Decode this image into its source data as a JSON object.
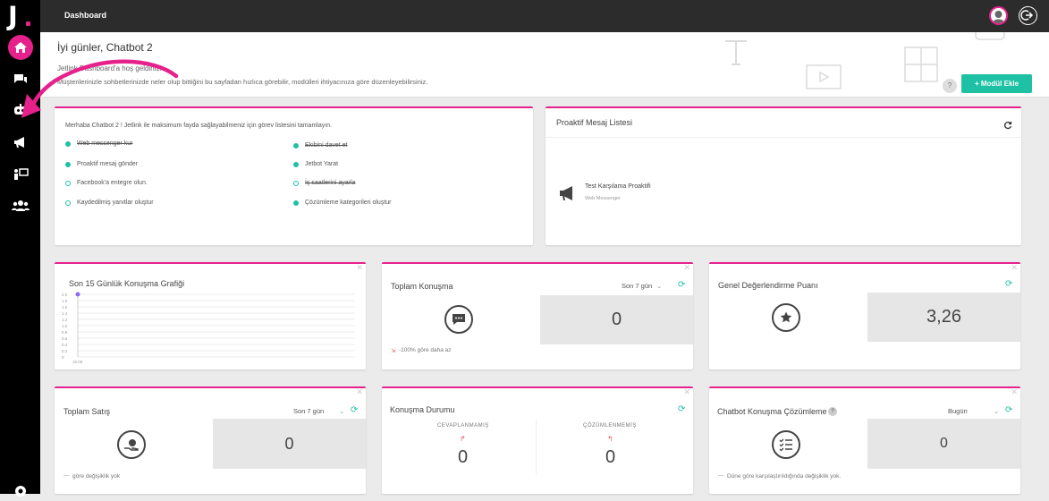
{
  "sidebar": {
    "logo": "J"
  },
  "topbar": {
    "title": "Dashboard"
  },
  "header": {
    "greeting": "İyi günler, Chatbot 2",
    "welcome": "Jetlink Dashboard'a hoş geldiniz!",
    "description": "Müşterilerinizle sohbetlerinizde neler olup bittiğini bu sayfadan hızlıca görebilir, modülleri ihtiyacınıza göre düzenleyebilirsiniz.",
    "help": "?",
    "add_module": "+ Modül Ekle"
  },
  "tasks_card": {
    "intro": "Merhaba Chatbot 2 ! Jetlink ile maksimum fayda sağlayabilmeniz için görev listesini tamamlayın.",
    "tasks": [
      {
        "label": "Web messenger kur",
        "done": true
      },
      {
        "label": "Ekibini davet et",
        "done": true
      },
      {
        "label": "Proaktif mesaj gönder",
        "done": false
      },
      {
        "label": "Jetbot Yarat",
        "done": false
      },
      {
        "label": "Facebook'a entegre olun.",
        "done": false
      },
      {
        "label": "İş saatlerini ayarla",
        "done": true
      },
      {
        "label": "Kaydedilmiş yanıtlar oluştur",
        "done": false
      },
      {
        "label": "Çözümleme kategorileri oluştur",
        "done": false
      }
    ]
  },
  "proactive": {
    "title": "Proaktif Mesaj Listesi",
    "item_title": "Test Karşılama Proaktifi",
    "item_sub": "Web Messenger"
  },
  "chart15": {
    "title": "Son 15 Günlük Konuşma Grafiği",
    "x_label": "16.06"
  },
  "chart_data": {
    "type": "line",
    "title": "Son 15 Günlük Konuşma Grafiği",
    "x": [
      "16.06"
    ],
    "ylim": [
      0,
      2
    ],
    "y_ticks": [
      "2.0",
      "1.8",
      "1.6",
      "1.4",
      "1.2",
      "1.0",
      "0.8",
      "0.6",
      "0.4",
      "0.2",
      "0"
    ],
    "series": [
      {
        "values": [
          2
        ]
      }
    ]
  },
  "total_conv": {
    "title": "Toplam Konuşma",
    "period": "Son 7 gün",
    "value": "0",
    "footer": "-100% göre daha az"
  },
  "rating": {
    "title": "Genel Değerlendirme Puanı",
    "value": "3,26"
  },
  "sales": {
    "title": "Toplam Satış",
    "period": "Son 7 gün",
    "value": "0",
    "footer": "göre değişiklik yok"
  },
  "status": {
    "title": "Konuşma Durumu",
    "unanswered_label": "CEVAPLANMAMIŞ",
    "unanswered_value": "0",
    "unresolved_label": "ÇÖZÜMLENMEMİŞ",
    "unresolved_value": "0"
  },
  "resolution": {
    "title": "Chatbot Konuşma Çözümleme",
    "period": "Bugün",
    "value": "0",
    "footer": "Düne göre karşılaştırıldığında değişiklik yok."
  },
  "colors": {
    "accent": "#e6218c",
    "teal": "#1ec1a4",
    "sidebar": "#000000",
    "topbar": "#2c2c2c"
  }
}
